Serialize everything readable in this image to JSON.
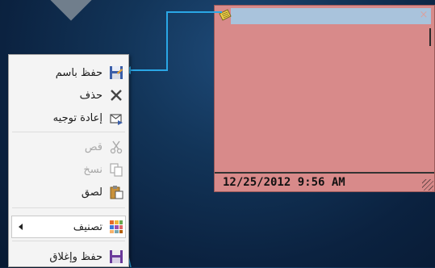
{
  "note": {
    "date_text": "12/25/2012 9:56 AM",
    "close_glyph": "×",
    "background_color": "#d88a8a",
    "titlebar_color": "#a9c3dc",
    "icon": "note-icon"
  },
  "menu": {
    "items": [
      {
        "label": "حفظ باسم",
        "icon": "save-as-icon",
        "enabled": true
      },
      {
        "label": "حذف",
        "icon": "delete-icon",
        "enabled": true
      },
      {
        "label": "إعادة توجيه",
        "icon": "forward-icon",
        "enabled": true
      },
      {
        "label": "قص",
        "icon": "cut-icon",
        "enabled": false
      },
      {
        "label": "نسخ",
        "icon": "copy-icon",
        "enabled": false
      },
      {
        "label": "لصق",
        "icon": "paste-icon",
        "enabled": true
      },
      {
        "label": "تصنيف",
        "icon": "categorize-icon",
        "enabled": true,
        "has_submenu": true
      },
      {
        "label": "حفظ وإغلاق",
        "icon": "save-close-icon",
        "enabled": true
      }
    ]
  },
  "colors": {
    "connector": "#2aa7e6"
  }
}
